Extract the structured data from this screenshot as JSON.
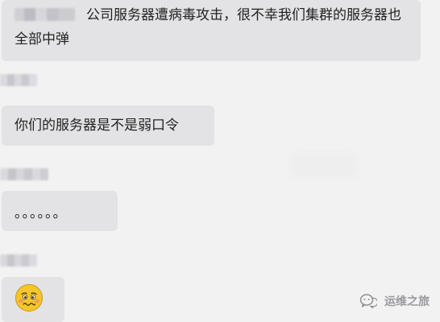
{
  "messages": [
    {
      "text": "公司服务器遭病毒攻击，很不幸我们集群的服务器也全部中弹"
    },
    {
      "text": "你们的服务器是不是弱口令"
    },
    {
      "text": "。。。。。。"
    },
    {
      "emoji": "worried-face-emoji"
    }
  ],
  "watermark": {
    "icon": "wechat-official-account-icon",
    "text": "运维之旅"
  },
  "colors": {
    "background": "#f2f2f2",
    "bubble": "#e3e3e5",
    "text": "#222222",
    "emoji_face": "#f3c62c"
  }
}
